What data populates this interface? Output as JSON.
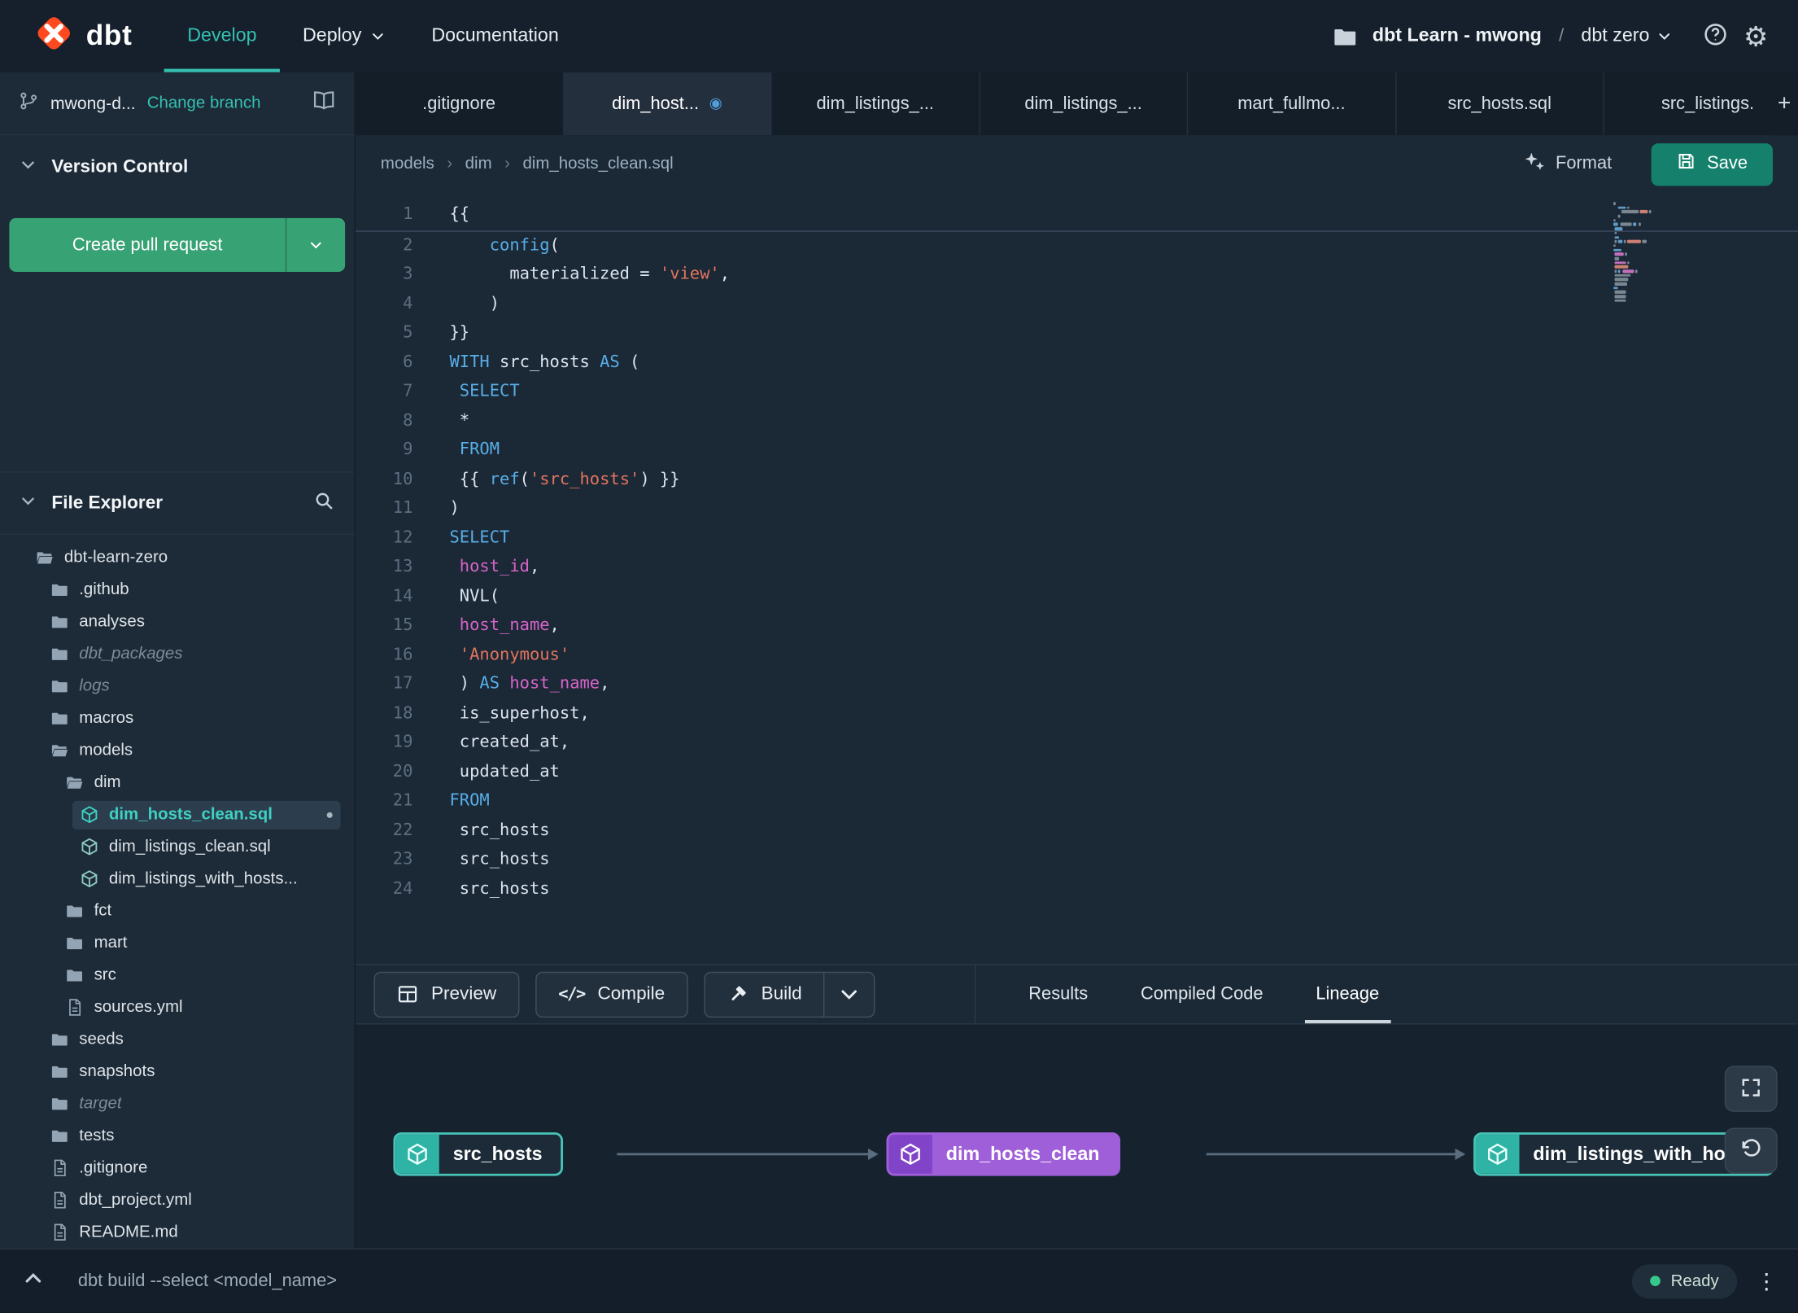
{
  "colors": {
    "accent_teal": "#35c0b2",
    "brand_orange": "#ff4a1f",
    "pr_button_green": "#37a273",
    "save_button_teal": "#15816c",
    "node_purple": "#9f5fd9",
    "node_teal_border": "#47c4b7",
    "status_ready_green": "#36c98e",
    "syntax_keyword": "#58aee6",
    "syntax_string": "#e2755f",
    "syntax_column": "#d765c8",
    "syntax_plain": "#dce5ee"
  },
  "topnav": {
    "logo_text": "dbt",
    "nav": [
      {
        "label": "Develop",
        "active": true,
        "caret": false
      },
      {
        "label": "Deploy",
        "active": false,
        "caret": true
      },
      {
        "label": "Documentation",
        "active": false,
        "caret": false
      }
    ],
    "project": "dbt Learn - mwong",
    "separator": "/",
    "env": "dbt zero"
  },
  "sidebar": {
    "branch": {
      "name": "mwong-d...",
      "change_label": "Change branch"
    },
    "version_control_label": "Version Control",
    "create_pr_label": "Create pull request",
    "file_explorer_label": "File Explorer",
    "tree": [
      {
        "label": "dbt-learn-zero",
        "type": "folder-open",
        "level": 0
      },
      {
        "label": ".github",
        "type": "folder",
        "level": 1
      },
      {
        "label": "analyses",
        "type": "folder",
        "level": 1
      },
      {
        "label": "dbt_packages",
        "type": "folder",
        "level": 1,
        "muted": true
      },
      {
        "label": "logs",
        "type": "folder",
        "level": 1,
        "muted": true
      },
      {
        "label": "macros",
        "type": "folder",
        "level": 1
      },
      {
        "label": "models",
        "type": "folder-open",
        "level": 1
      },
      {
        "label": "dim",
        "type": "folder-open",
        "level": 2
      },
      {
        "label": "dim_hosts_clean.sql",
        "type": "model",
        "level": 3,
        "selected": true,
        "modified": true
      },
      {
        "label": "dim_listings_clean.sql",
        "type": "model",
        "level": 3
      },
      {
        "label": "dim_listings_with_hosts...",
        "type": "model",
        "level": 3
      },
      {
        "label": "fct",
        "type": "folder",
        "level": 2
      },
      {
        "label": "mart",
        "type": "folder",
        "level": 2
      },
      {
        "label": "src",
        "type": "folder",
        "level": 2
      },
      {
        "label": "sources.yml",
        "type": "file",
        "level": 2
      },
      {
        "label": "seeds",
        "type": "folder",
        "level": 1
      },
      {
        "label": "snapshots",
        "type": "folder",
        "level": 1
      },
      {
        "label": "target",
        "type": "folder",
        "level": 1,
        "muted": true
      },
      {
        "label": "tests",
        "type": "folder",
        "level": 1
      },
      {
        "label": ".gitignore",
        "type": "file",
        "level": 1
      },
      {
        "label": "dbt_project.yml",
        "type": "file",
        "level": 1
      },
      {
        "label": "README.md",
        "type": "file",
        "level": 1
      }
    ]
  },
  "editor": {
    "tabs": [
      {
        "label": ".gitignore"
      },
      {
        "label": "dim_host...",
        "active": true,
        "dot": true
      },
      {
        "label": "dim_listings_..."
      },
      {
        "label": "dim_listings_..."
      },
      {
        "label": "mart_fullmo..."
      },
      {
        "label": "src_hosts.sql"
      },
      {
        "label": "src_listings."
      }
    ],
    "new_tab_icon": "+",
    "breadcrumb": [
      "models",
      "dim",
      "dim_hosts_clean.sql"
    ],
    "format_label": "Format",
    "save_label": "Save",
    "code": [
      {
        "n": 1,
        "segs": [
          [
            "{{",
            "pl"
          ]
        ]
      },
      {
        "n": 2,
        "segs": [
          [
            "    ",
            "pl"
          ],
          [
            "config",
            "kw"
          ],
          [
            "(",
            "pl"
          ]
        ]
      },
      {
        "n": 3,
        "segs": [
          [
            "      materialized = ",
            "pl"
          ],
          [
            "'view'",
            "str"
          ],
          [
            ",",
            "pl"
          ]
        ]
      },
      {
        "n": 4,
        "segs": [
          [
            "    )",
            "pl"
          ]
        ]
      },
      {
        "n": 5,
        "segs": [
          [
            "}}",
            "pl"
          ]
        ]
      },
      {
        "n": 6,
        "segs": [
          [
            "WITH",
            "kw"
          ],
          [
            " src_hosts ",
            "pl"
          ],
          [
            "AS",
            "kw"
          ],
          [
            " (",
            "pl"
          ]
        ]
      },
      {
        "n": 7,
        "segs": [
          [
            " ",
            "pl"
          ],
          [
            "SELECT",
            "kw"
          ]
        ]
      },
      {
        "n": 8,
        "segs": [
          [
            " *",
            "pl"
          ]
        ]
      },
      {
        "n": 9,
        "segs": [
          [
            " ",
            "pl"
          ],
          [
            "FROM",
            "kw"
          ]
        ]
      },
      {
        "n": 10,
        "segs": [
          [
            " {{ ",
            "pl"
          ],
          [
            "ref",
            "kw"
          ],
          [
            "(",
            "pl"
          ],
          [
            "'src_hosts'",
            "str"
          ],
          [
            ") }}",
            "pl"
          ]
        ]
      },
      {
        "n": 11,
        "segs": [
          [
            ")",
            "pl"
          ]
        ]
      },
      {
        "n": 12,
        "segs": [
          [
            "SELECT",
            "kw"
          ]
        ]
      },
      {
        "n": 13,
        "segs": [
          [
            " ",
            "pl"
          ],
          [
            "host_id",
            "col"
          ],
          [
            ",",
            "pl"
          ]
        ]
      },
      {
        "n": 14,
        "segs": [
          [
            " NVL(",
            "pl"
          ]
        ]
      },
      {
        "n": 15,
        "segs": [
          [
            " ",
            "pl"
          ],
          [
            "host_name",
            "col"
          ],
          [
            ",",
            "pl"
          ]
        ]
      },
      {
        "n": 16,
        "segs": [
          [
            " ",
            "pl"
          ],
          [
            "'Anonymous'",
            "str"
          ]
        ]
      },
      {
        "n": 17,
        "segs": [
          [
            " ) ",
            "pl"
          ],
          [
            "AS",
            "kw"
          ],
          [
            " ",
            "pl"
          ],
          [
            "host_name",
            "col"
          ],
          [
            ",",
            "pl"
          ]
        ]
      },
      {
        "n": 18,
        "segs": [
          [
            " is_superhost,",
            "pl"
          ]
        ]
      },
      {
        "n": 19,
        "segs": [
          [
            " created_at,",
            "pl"
          ]
        ]
      },
      {
        "n": 20,
        "segs": [
          [
            " updated_at",
            "pl"
          ]
        ]
      },
      {
        "n": 21,
        "segs": [
          [
            "FROM",
            "kw"
          ]
        ]
      },
      {
        "n": 22,
        "segs": [
          [
            " src_hosts",
            "pl"
          ]
        ]
      },
      {
        "n": 23,
        "segs": [
          [
            " src_hosts",
            "pl"
          ]
        ]
      },
      {
        "n": 24,
        "segs": [
          [
            " src_hosts",
            "pl"
          ]
        ]
      }
    ]
  },
  "bottom_panel": {
    "actions": [
      {
        "label": "Preview",
        "icon": "table"
      },
      {
        "label": "Compile",
        "icon": "code"
      },
      {
        "label": "Build",
        "icon": "hammer",
        "split": true
      }
    ],
    "tabs": [
      {
        "label": "Results"
      },
      {
        "label": "Compiled Code"
      },
      {
        "label": "Lineage",
        "active": true
      }
    ],
    "lineage": {
      "nodes": [
        {
          "label": "src_hosts",
          "style": "teal"
        },
        {
          "label": "dim_hosts_clean",
          "style": "purple"
        },
        {
          "label": "dim_listings_with_hosts",
          "style": "teal"
        }
      ]
    }
  },
  "statusbar": {
    "command": "dbt build --select <model_name>",
    "status": "Ready"
  }
}
